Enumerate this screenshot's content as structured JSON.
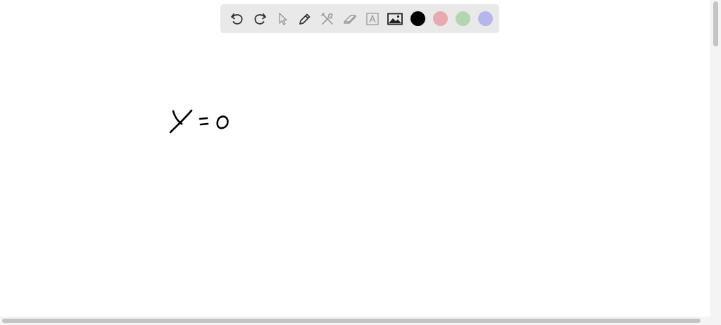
{
  "toolbar": {
    "tools": [
      "undo-icon",
      "redo-icon",
      "select-pointer-icon",
      "pen-icon",
      "tools-icon",
      "eraser-icon",
      "text-box-icon",
      "image-icon"
    ],
    "colors": {
      "black": "#000000",
      "red": "#e8aab0",
      "green": "#b3d6b1",
      "blue": "#b5b7ec"
    },
    "toolbar_background": "#e9e9e9"
  },
  "canvas": {
    "background": "#ffffff",
    "handwriting": "y = 0"
  }
}
